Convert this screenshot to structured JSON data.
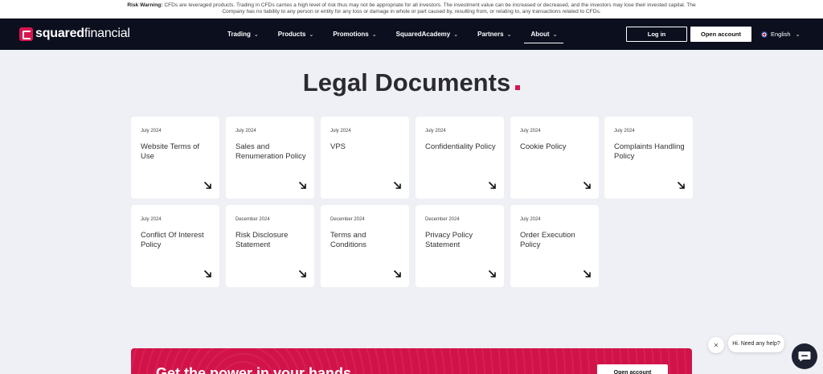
{
  "risk_warning": {
    "label": "Risk Warning:",
    "text": "CFDs are leveraged products. Trading in CFDs carries a high level of risk thus may not be appropriate for all investors. The investment value can be increased or decreased, and the investors may lose their invested capital. The Company has no liability to any person or entity for any loss or damage in whole or part caused by, resulting from, or relating to, any transactions related to CFDs."
  },
  "nav": {
    "logo_bold": "squared",
    "logo_regular": "financial",
    "menu": [
      {
        "label": "Trading"
      },
      {
        "label": "Products"
      },
      {
        "label": "Promotions"
      },
      {
        "label": "SquaredAcademy"
      },
      {
        "label": "Partners"
      },
      {
        "label": "About"
      }
    ],
    "login": "Log in",
    "open_account": "Open account",
    "language": "English"
  },
  "page": {
    "title": "Legal Documents"
  },
  "documents": [
    {
      "date": "July 2024",
      "name": "Website Terms of Use"
    },
    {
      "date": "July 2024",
      "name": "Sales and Renumeration Policy"
    },
    {
      "date": "July 2024",
      "name": "VPS"
    },
    {
      "date": "July 2024",
      "name": "Confidentiality Policy"
    },
    {
      "date": "July 2024",
      "name": "Cookie Policy"
    },
    {
      "date": "July 2024",
      "name": "Complaints Handling Policy"
    },
    {
      "date": "July 2024",
      "name": "Conflict Of Interest Policy"
    },
    {
      "date": "December 2024",
      "name": "Risk Disclosure Statement"
    },
    {
      "date": "December 2024",
      "name": "Terms and Conditions"
    },
    {
      "date": "December 2024",
      "name": "Privacy Policy Statement"
    },
    {
      "date": "July 2024",
      "name": "Order Execution Policy"
    }
  ],
  "banner": {
    "text": "Get the power in your hands",
    "button": "Open account"
  },
  "chat": {
    "greeting": "Hi. Need any help?",
    "close_glyph": "✕"
  },
  "colors": {
    "brand": "#d6164f",
    "nav_bg": "#0b0f1e",
    "page_bg": "#eef0f5"
  }
}
